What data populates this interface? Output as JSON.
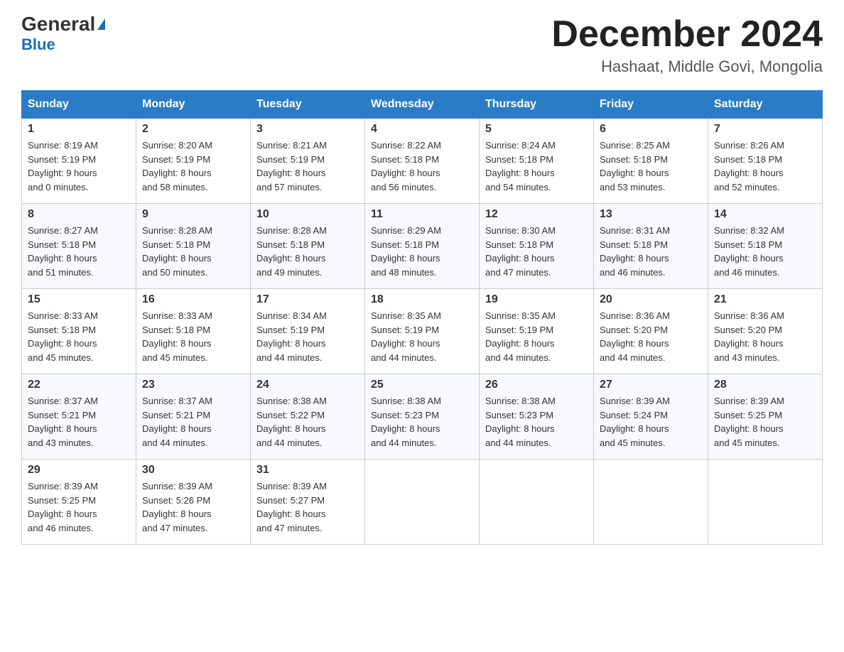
{
  "logo": {
    "general": "General",
    "blue": "Blue"
  },
  "header": {
    "month": "December 2024",
    "location": "Hashaat, Middle Govi, Mongolia"
  },
  "weekdays": [
    "Sunday",
    "Monday",
    "Tuesday",
    "Wednesday",
    "Thursday",
    "Friday",
    "Saturday"
  ],
  "weeks": [
    [
      {
        "day": "1",
        "sunrise": "8:19 AM",
        "sunset": "5:19 PM",
        "daylight": "9 hours and 0 minutes."
      },
      {
        "day": "2",
        "sunrise": "8:20 AM",
        "sunset": "5:19 PM",
        "daylight": "8 hours and 58 minutes."
      },
      {
        "day": "3",
        "sunrise": "8:21 AM",
        "sunset": "5:19 PM",
        "daylight": "8 hours and 57 minutes."
      },
      {
        "day": "4",
        "sunrise": "8:22 AM",
        "sunset": "5:18 PM",
        "daylight": "8 hours and 56 minutes."
      },
      {
        "day": "5",
        "sunrise": "8:24 AM",
        "sunset": "5:18 PM",
        "daylight": "8 hours and 54 minutes."
      },
      {
        "day": "6",
        "sunrise": "8:25 AM",
        "sunset": "5:18 PM",
        "daylight": "8 hours and 53 minutes."
      },
      {
        "day": "7",
        "sunrise": "8:26 AM",
        "sunset": "5:18 PM",
        "daylight": "8 hours and 52 minutes."
      }
    ],
    [
      {
        "day": "8",
        "sunrise": "8:27 AM",
        "sunset": "5:18 PM",
        "daylight": "8 hours and 51 minutes."
      },
      {
        "day": "9",
        "sunrise": "8:28 AM",
        "sunset": "5:18 PM",
        "daylight": "8 hours and 50 minutes."
      },
      {
        "day": "10",
        "sunrise": "8:28 AM",
        "sunset": "5:18 PM",
        "daylight": "8 hours and 49 minutes."
      },
      {
        "day": "11",
        "sunrise": "8:29 AM",
        "sunset": "5:18 PM",
        "daylight": "8 hours and 48 minutes."
      },
      {
        "day": "12",
        "sunrise": "8:30 AM",
        "sunset": "5:18 PM",
        "daylight": "8 hours and 47 minutes."
      },
      {
        "day": "13",
        "sunrise": "8:31 AM",
        "sunset": "5:18 PM",
        "daylight": "8 hours and 46 minutes."
      },
      {
        "day": "14",
        "sunrise": "8:32 AM",
        "sunset": "5:18 PM",
        "daylight": "8 hours and 46 minutes."
      }
    ],
    [
      {
        "day": "15",
        "sunrise": "8:33 AM",
        "sunset": "5:18 PM",
        "daylight": "8 hours and 45 minutes."
      },
      {
        "day": "16",
        "sunrise": "8:33 AM",
        "sunset": "5:18 PM",
        "daylight": "8 hours and 45 minutes."
      },
      {
        "day": "17",
        "sunrise": "8:34 AM",
        "sunset": "5:19 PM",
        "daylight": "8 hours and 44 minutes."
      },
      {
        "day": "18",
        "sunrise": "8:35 AM",
        "sunset": "5:19 PM",
        "daylight": "8 hours and 44 minutes."
      },
      {
        "day": "19",
        "sunrise": "8:35 AM",
        "sunset": "5:19 PM",
        "daylight": "8 hours and 44 minutes."
      },
      {
        "day": "20",
        "sunrise": "8:36 AM",
        "sunset": "5:20 PM",
        "daylight": "8 hours and 44 minutes."
      },
      {
        "day": "21",
        "sunrise": "8:36 AM",
        "sunset": "5:20 PM",
        "daylight": "8 hours and 43 minutes."
      }
    ],
    [
      {
        "day": "22",
        "sunrise": "8:37 AM",
        "sunset": "5:21 PM",
        "daylight": "8 hours and 43 minutes."
      },
      {
        "day": "23",
        "sunrise": "8:37 AM",
        "sunset": "5:21 PM",
        "daylight": "8 hours and 44 minutes."
      },
      {
        "day": "24",
        "sunrise": "8:38 AM",
        "sunset": "5:22 PM",
        "daylight": "8 hours and 44 minutes."
      },
      {
        "day": "25",
        "sunrise": "8:38 AM",
        "sunset": "5:23 PM",
        "daylight": "8 hours and 44 minutes."
      },
      {
        "day": "26",
        "sunrise": "8:38 AM",
        "sunset": "5:23 PM",
        "daylight": "8 hours and 44 minutes."
      },
      {
        "day": "27",
        "sunrise": "8:39 AM",
        "sunset": "5:24 PM",
        "daylight": "8 hours and 45 minutes."
      },
      {
        "day": "28",
        "sunrise": "8:39 AM",
        "sunset": "5:25 PM",
        "daylight": "8 hours and 45 minutes."
      }
    ],
    [
      {
        "day": "29",
        "sunrise": "8:39 AM",
        "sunset": "5:25 PM",
        "daylight": "8 hours and 46 minutes."
      },
      {
        "day": "30",
        "sunrise": "8:39 AM",
        "sunset": "5:26 PM",
        "daylight": "8 hours and 47 minutes."
      },
      {
        "day": "31",
        "sunrise": "8:39 AM",
        "sunset": "5:27 PM",
        "daylight": "8 hours and 47 minutes."
      },
      null,
      null,
      null,
      null
    ]
  ],
  "labels": {
    "sunrise": "Sunrise:",
    "sunset": "Sunset:",
    "daylight": "Daylight:"
  }
}
